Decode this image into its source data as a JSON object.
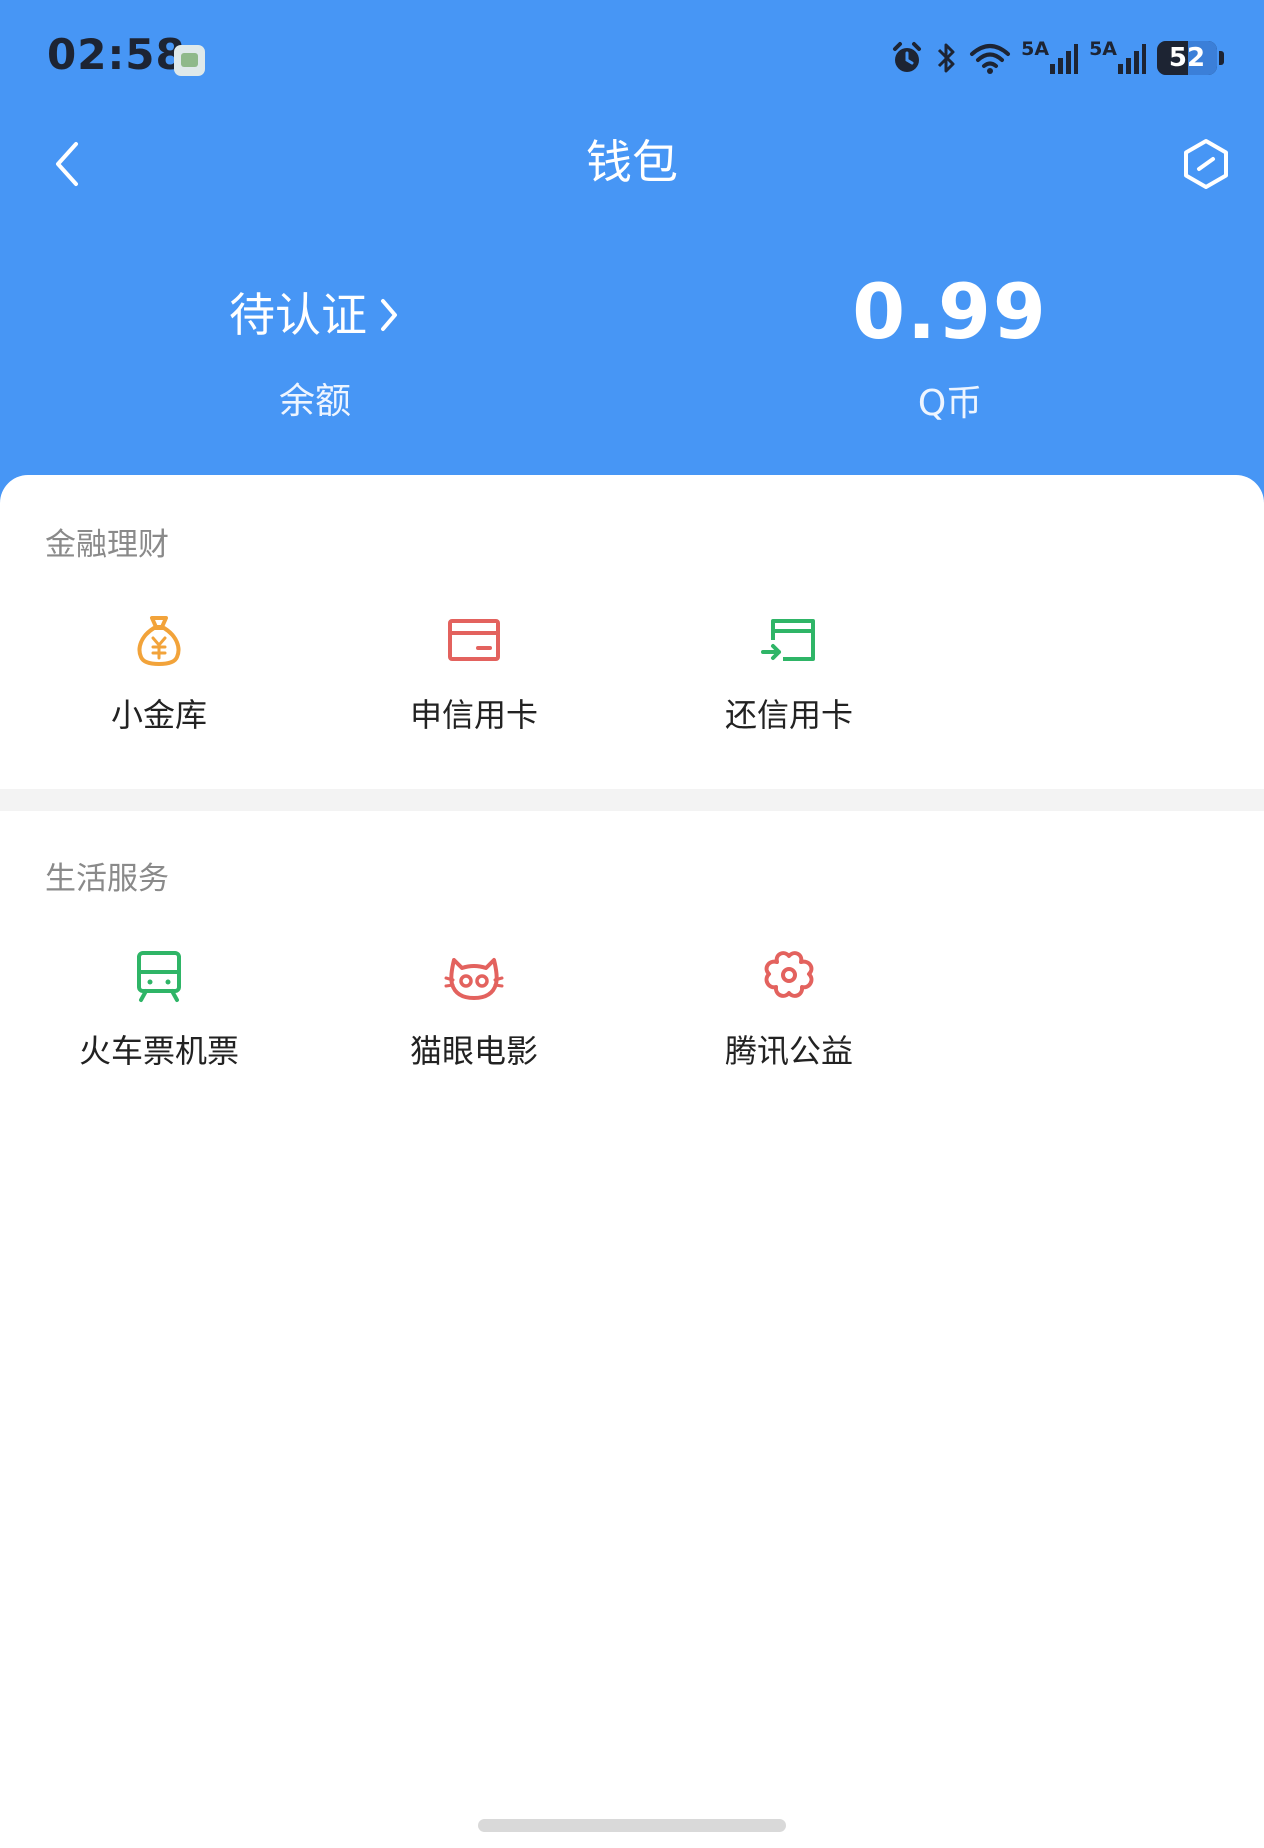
{
  "status_bar": {
    "time": "02:58",
    "network_1": "5A",
    "network_2": "5A",
    "battery_percent": 52,
    "battery_label": "52"
  },
  "nav": {
    "title": "钱包",
    "back_icon": "chevron-left-icon",
    "settings_icon": "hexagon-settings-icon"
  },
  "balance": {
    "left_value": "待认证",
    "left_label": "余额",
    "right_value": "0.99",
    "right_label": "Q币"
  },
  "finance": {
    "title": "金融理财",
    "items": [
      {
        "label": "小金库",
        "icon": "money-bag-icon",
        "color": "#f2a33a"
      },
      {
        "label": "申信用卡",
        "icon": "credit-card-icon",
        "color": "#e3625e"
      },
      {
        "label": "还信用卡",
        "icon": "card-repay-icon",
        "color": "#2fb567"
      }
    ]
  },
  "life": {
    "title": "生活服务",
    "items": [
      {
        "label": "火车票机票",
        "icon": "train-icon",
        "color": "#2fb567"
      },
      {
        "label": "猫眼电影",
        "icon": "cat-face-icon",
        "color": "#e3625e"
      },
      {
        "label": "腾讯公益",
        "icon": "flower-icon",
        "color": "#e3625e"
      }
    ]
  },
  "colors": {
    "header_bg": "#4796f5",
    "divider": "#f3f3f3"
  }
}
